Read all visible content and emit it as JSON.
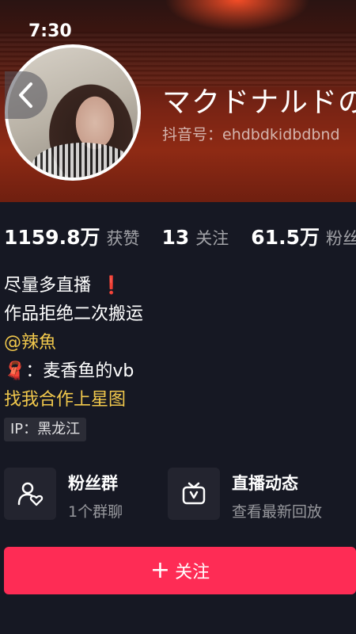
{
  "status_bar": {
    "time": "7:30"
  },
  "profile": {
    "nickname": "マクドナルドの",
    "douyin_id": "抖音号：ehdbdkidbdbnd"
  },
  "stats": [
    {
      "value": "1159.8万",
      "label": "获赞"
    },
    {
      "value": "13",
      "label": "关注"
    },
    {
      "value": "61.5万",
      "label": "粉丝"
    }
  ],
  "bio": {
    "line1": "尽量多直播",
    "line1_mark": "❗",
    "line2": "作品拒绝二次搬运",
    "mention": "@辣魚",
    "line4": "：麦香鱼的vb",
    "line4_emoji": "🧣",
    "link": "找我合作上星图"
  },
  "ip_tag": "IP：黑龙江",
  "cards": {
    "fans_group": {
      "title": "粉丝群",
      "subtitle": "1个群聊"
    },
    "live": {
      "title": "直播动态",
      "subtitle": "查看最新回放"
    }
  },
  "follow_button": {
    "plus": "+",
    "label": "关注"
  },
  "colors": {
    "accent": "#fe2c55",
    "link": "#f2c94c",
    "background": "#161823"
  }
}
